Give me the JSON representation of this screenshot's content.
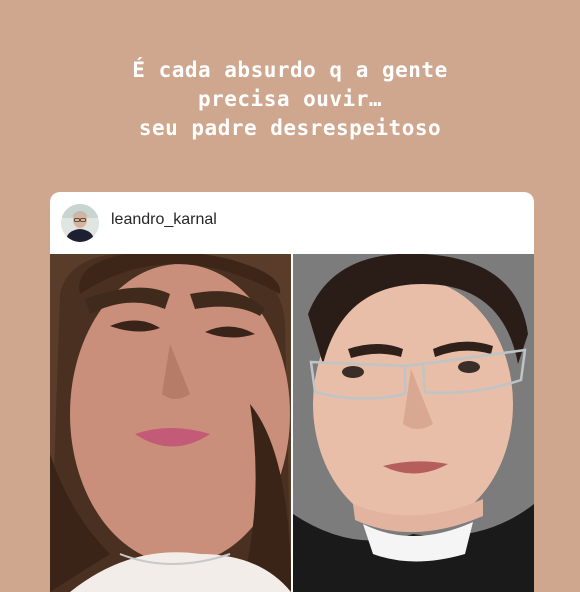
{
  "story": {
    "caption_lines": [
      "É cada absurdo q a gente",
      "precisa ouvir…",
      "seu padre desrespeitoso"
    ]
  },
  "post": {
    "username": "leandro_karnal",
    "avatar_icon": "profile-avatar-icon",
    "photos": [
      "woman-selfie-photo",
      "priest-portrait-photo"
    ]
  },
  "colors": {
    "background": "#cfa68e",
    "caption": "#ffffff",
    "card": "#ffffff",
    "username": "#262626"
  }
}
